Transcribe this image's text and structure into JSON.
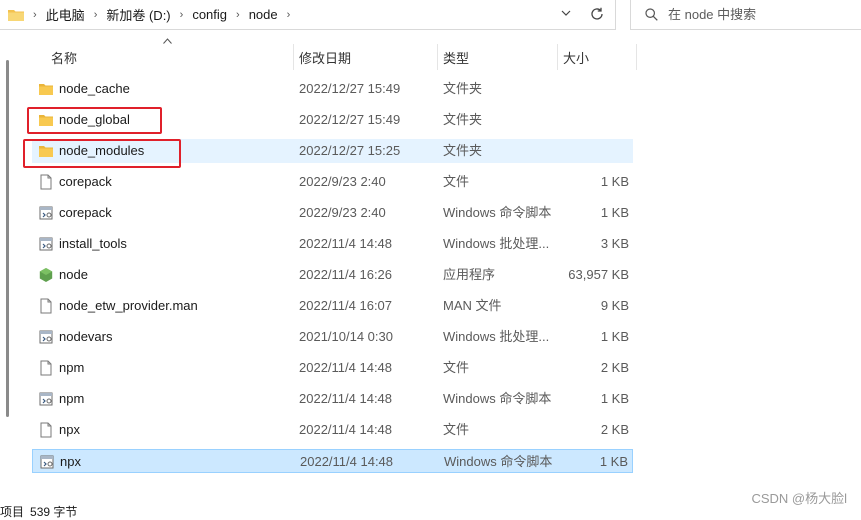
{
  "address": {
    "crumbs": [
      "此电脑",
      "新加卷 (D:)",
      "config",
      "node"
    ]
  },
  "search": {
    "placeholder": "在 node 中搜索"
  },
  "columns": {
    "name": "名称",
    "date": "修改日期",
    "type": "类型",
    "size": "大小"
  },
  "files": [
    {
      "name": "node_cache",
      "date": "2022/12/27 15:49",
      "type": "文件夹",
      "size": "",
      "icon": "folder-icon"
    },
    {
      "name": "node_global",
      "date": "2022/12/27 15:49",
      "type": "文件夹",
      "size": "",
      "icon": "folder-icon"
    },
    {
      "name": "node_modules",
      "date": "2022/12/27 15:25",
      "type": "文件夹",
      "size": "",
      "icon": "folder-icon"
    },
    {
      "name": "corepack",
      "date": "2022/9/23 2:40",
      "type": "文件",
      "size": "1 KB",
      "icon": "file-icon"
    },
    {
      "name": "corepack",
      "date": "2022/9/23 2:40",
      "type": "Windows 命令脚本",
      "size": "1 KB",
      "icon": "script-icon"
    },
    {
      "name": "install_tools",
      "date": "2022/11/4 14:48",
      "type": "Windows 批处理...",
      "size": "3 KB",
      "icon": "script-icon"
    },
    {
      "name": "node",
      "date": "2022/11/4 16:26",
      "type": "应用程序",
      "size": "63,957 KB",
      "icon": "node-app-icon"
    },
    {
      "name": "node_etw_provider.man",
      "date": "2022/11/4 16:07",
      "type": "MAN 文件",
      "size": "9 KB",
      "icon": "file-icon"
    },
    {
      "name": "nodevars",
      "date": "2021/10/14 0:30",
      "type": "Windows 批处理...",
      "size": "1 KB",
      "icon": "script-icon"
    },
    {
      "name": "npm",
      "date": "2022/11/4 14:48",
      "type": "文件",
      "size": "2 KB",
      "icon": "file-icon"
    },
    {
      "name": "npm",
      "date": "2022/11/4 14:48",
      "type": "Windows 命令脚本",
      "size": "1 KB",
      "icon": "script-icon"
    },
    {
      "name": "npx",
      "date": "2022/11/4 14:48",
      "type": "文件",
      "size": "2 KB",
      "icon": "file-icon"
    },
    {
      "name": "npx",
      "date": "2022/11/4 14:48",
      "type": "Windows 命令脚本",
      "size": "1 KB",
      "icon": "script-icon"
    }
  ],
  "status": {
    "count": "项目",
    "size": "539 字节"
  },
  "watermark": "CSDN @杨大脸l",
  "colors": {
    "highlight_box": "#e0202a",
    "selected_row": "#cce8ff",
    "hover_row": "#e5f3ff",
    "folder": "#f8c950"
  }
}
